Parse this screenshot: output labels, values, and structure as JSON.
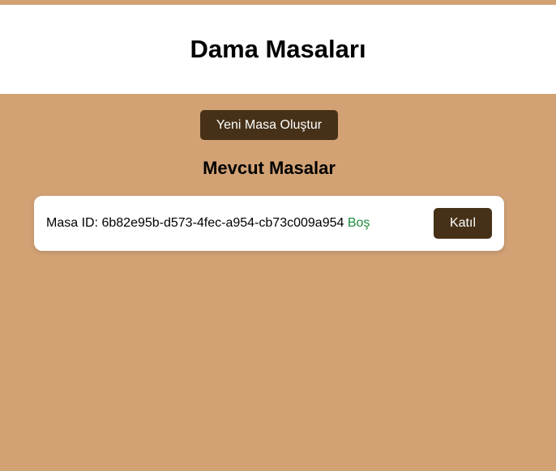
{
  "header": {
    "title": "Dama Masaları"
  },
  "actions": {
    "create_table_label": "Yeni Masa Oluştur"
  },
  "tables_section": {
    "title": "Mevcut Masalar",
    "tables": [
      {
        "id_label": "Masa ID:",
        "id": "6b82e95b-d573-4fec-a954-cb73c009a954",
        "status": "Boş",
        "join_label": "Katıl"
      }
    ]
  },
  "colors": {
    "background": "#d2a275",
    "button": "#463118",
    "status_empty": "#1e8a3c"
  }
}
